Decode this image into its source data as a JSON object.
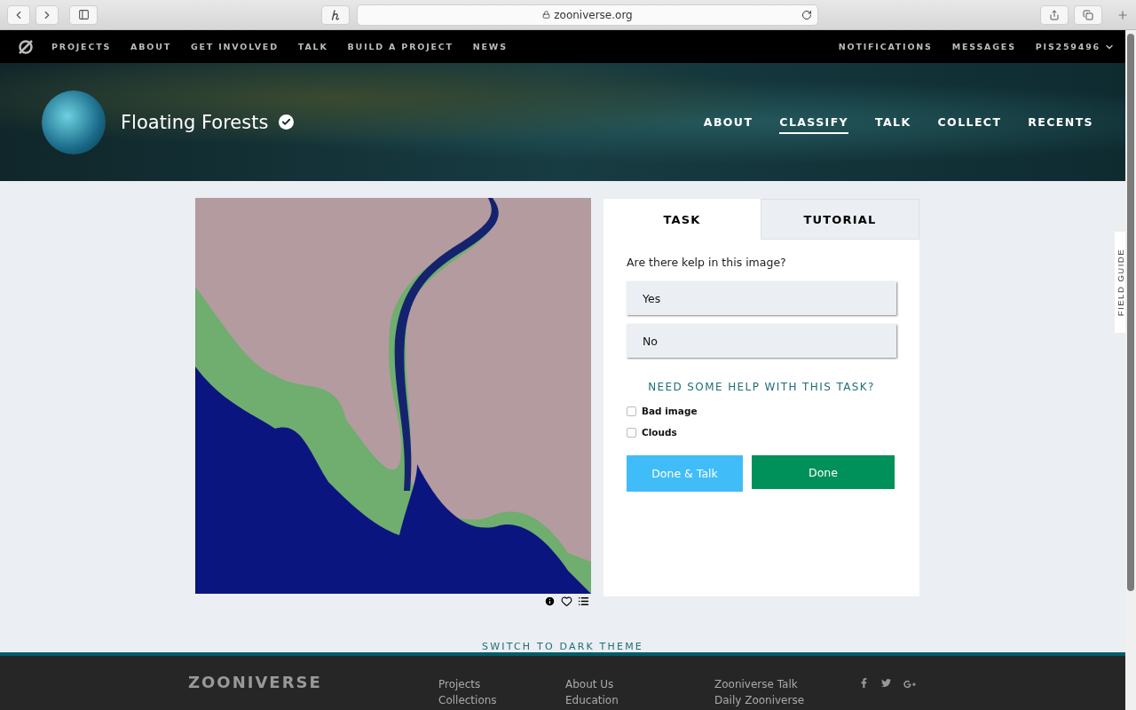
{
  "browser": {
    "url": "zooniverse.org"
  },
  "nav": {
    "items": [
      "PROJECTS",
      "ABOUT",
      "GET INVOLVED",
      "TALK",
      "BUILD A PROJECT",
      "NEWS"
    ],
    "right_items": [
      "NOTIFICATIONS",
      "MESSAGES"
    ],
    "user": "PIS259496"
  },
  "project": {
    "title": "Floating Forests",
    "verified": true,
    "tabs": [
      {
        "label": "ABOUT",
        "selected": false
      },
      {
        "label": "CLASSIFY",
        "selected": true
      },
      {
        "label": "TALK",
        "selected": false
      },
      {
        "label": "COLLECT",
        "selected": false
      },
      {
        "label": "RECENTS",
        "selected": false
      }
    ]
  },
  "classifier": {
    "tabs": [
      {
        "label": "TASK",
        "selected": true
      },
      {
        "label": "TUTORIAL",
        "selected": false
      }
    ],
    "question": "Are there kelp in this image?",
    "answers": [
      {
        "label": "Yes",
        "selected": false
      },
      {
        "label": "No",
        "selected": false
      }
    ],
    "help_link": "NEED SOME HELP WITH THIS TASK?",
    "checkboxes": [
      {
        "label": "Bad image",
        "checked": false
      },
      {
        "label": "Clouds",
        "checked": false
      }
    ],
    "buttons": [
      {
        "label": "Done & Talk",
        "kind": "talk"
      },
      {
        "label": "Done",
        "kind": "done"
      }
    ]
  },
  "field_guide": "FIELD GUIDE",
  "theme_toggle": "SWITCH TO DARK THEME",
  "footer": {
    "logo": "ZOONIVERSE",
    "columns": [
      [
        "Projects",
        "Collections"
      ],
      [
        "About Us",
        "Education"
      ],
      [
        "Zooniverse Talk",
        "Daily Zooniverse"
      ]
    ]
  }
}
